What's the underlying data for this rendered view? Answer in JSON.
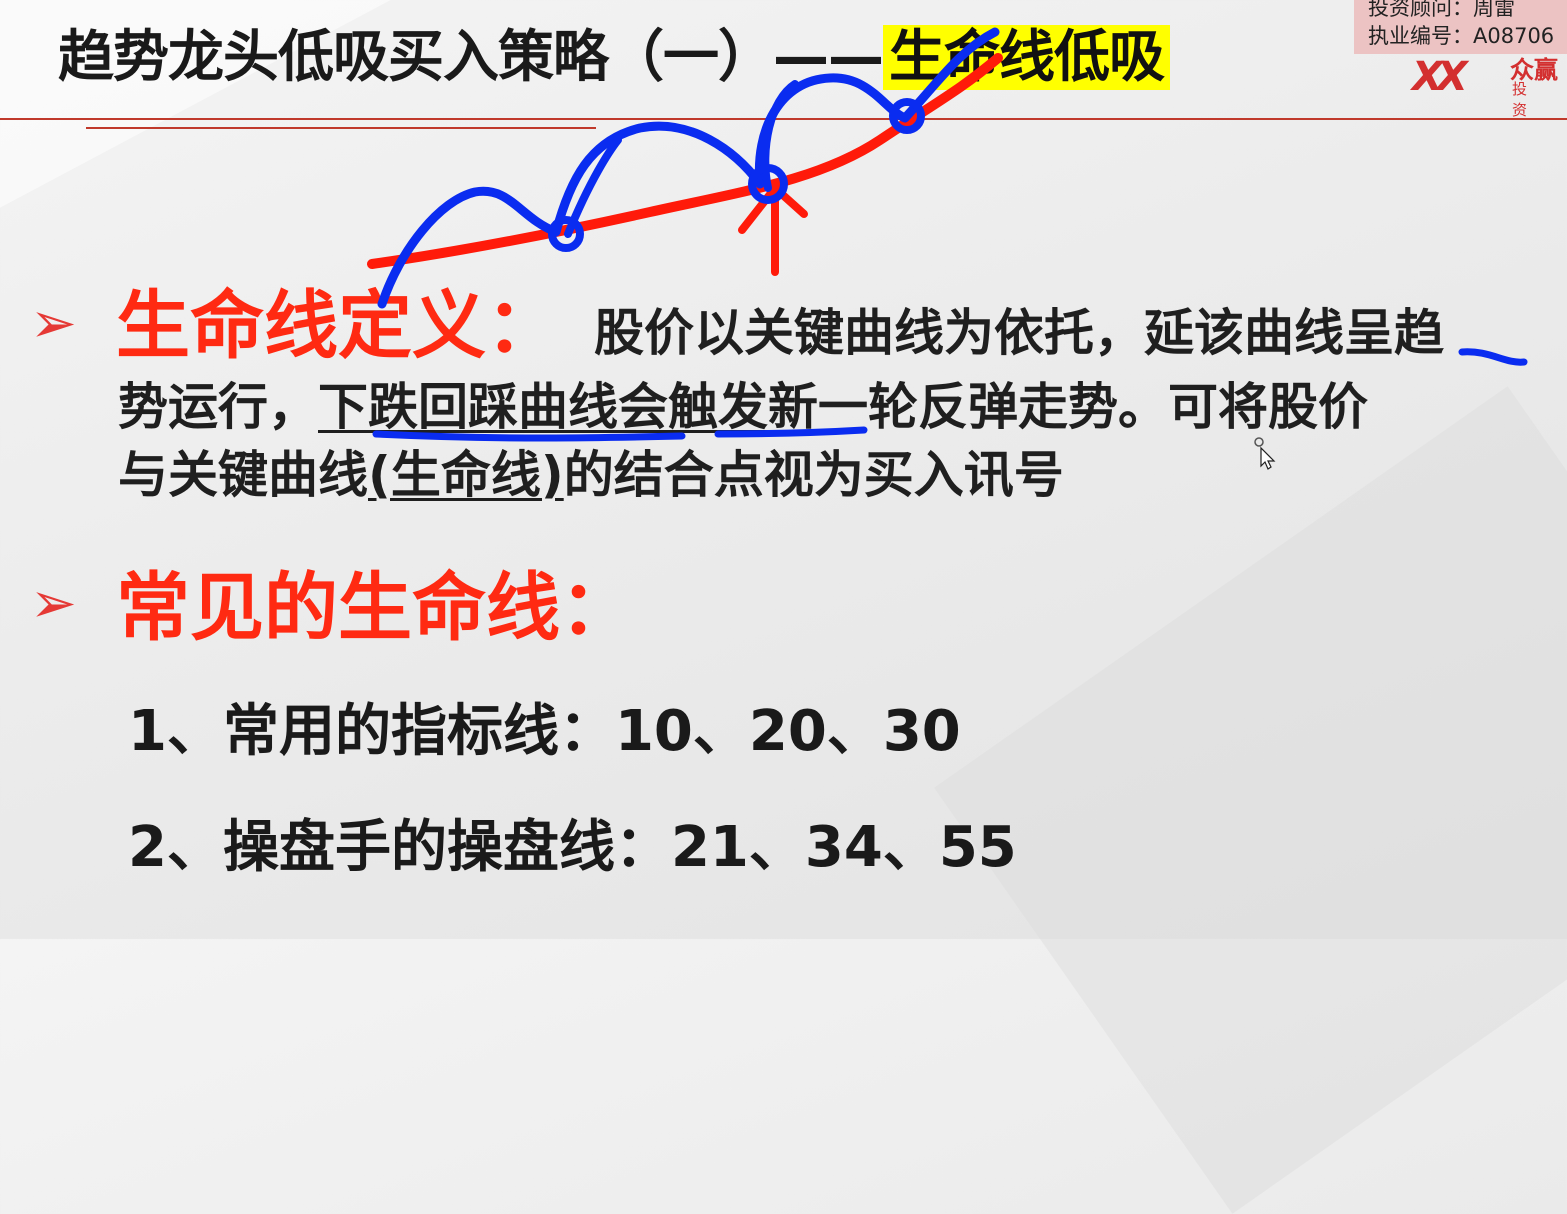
{
  "slide": {
    "title_main": "趋势龙头低吸买入策略（一）——",
    "title_highlight": "生命线低吸"
  },
  "watermark": {
    "line1": "投资顾问：周雷",
    "line2": "执业编号：A08706"
  },
  "logo": {
    "name": "众赢",
    "sub": "投资"
  },
  "section1": {
    "bullet": "➢",
    "heading": "生命线定义：",
    "line1_text": "股价以关键曲线为依托，延该曲线呈趋",
    "line2_a": "势运行，",
    "line2_b": "下跌回踩曲线会触发",
    "line2_c": "新一轮反弹走势。可将股价",
    "line3_a": "与关键曲线",
    "line3_b": "(生命线)",
    "line3_c": "的结合点视为买入讯号"
  },
  "section2": {
    "bullet": "➢",
    "heading": "常见的生命线："
  },
  "items": [
    "1、常用的指标线：10、20、30",
    "2、操盘手的操盘线：21、34、55"
  ],
  "colors": {
    "title_highlight_bg": "#ffff00",
    "heading_red": "#ff2a12",
    "ink_red": "#ff1a0a",
    "ink_blue": "#0a2cf0",
    "rule_red": "#c0392b"
  },
  "icons": [
    "bullet-arrow-icon",
    "mouse-cursor-icon",
    "logo-icon"
  ]
}
